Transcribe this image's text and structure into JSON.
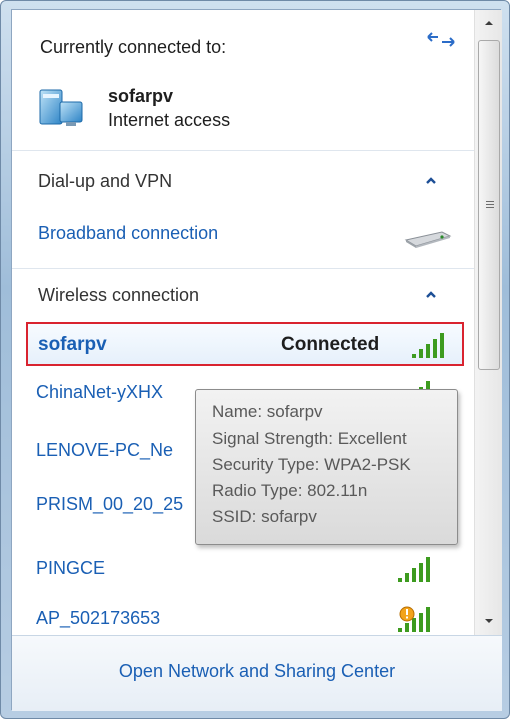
{
  "current": {
    "title": "Currently connected to:",
    "network_name": "sofarpv",
    "network_status": "Internet access",
    "network_icon": "network-computer-icon",
    "refresh_icon": "refresh-arrows-icon"
  },
  "groups": {
    "dialup": {
      "label": "Dial-up and VPN"
    },
    "wireless": {
      "label": "Wireless connection"
    }
  },
  "broadband": {
    "label": "Broadband connection",
    "icon": "broadband-modem-icon"
  },
  "wifi": {
    "selected": {
      "name": "sofarpv",
      "status": "Connected",
      "signal_bars": 5
    },
    "networks": [
      {
        "name": "ChinaNet-yXHX",
        "signal_bars": 5
      },
      {
        "name": "LENOVE-PC_Ne",
        "signal_bars": 5
      },
      {
        "name": "PRISM_00_20_25",
        "signal_bars": 5
      },
      {
        "name": "PINGCE",
        "signal_bars": 5
      },
      {
        "name": "AP_502173653",
        "signal_bars": 5,
        "security_warning": true
      }
    ]
  },
  "tooltip": {
    "name": "Name: sofarpv",
    "signal": "Signal Strength: Excellent",
    "security": "Security Type: WPA2-PSK",
    "radio": "Radio Type: 802.11n",
    "ssid": "SSID: sofarpv"
  },
  "footer": {
    "link": "Open Network and Sharing Center"
  },
  "colors": {
    "link": "#1a5fb4",
    "signal_green": "#3d9b1f",
    "highlight_border": "#d9232f"
  }
}
